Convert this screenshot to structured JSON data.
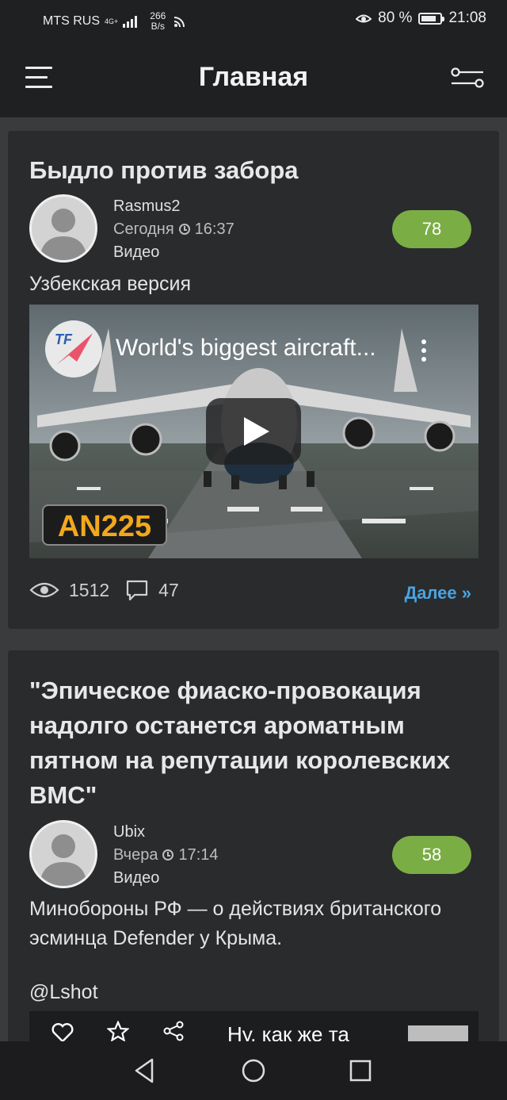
{
  "status_bar": {
    "carrier": "MTS RUS",
    "network": "4G+",
    "speed_value": "266",
    "speed_unit": "B/s",
    "battery_percent": "80 %",
    "battery_level": 0.8,
    "time": "21:08"
  },
  "app_bar": {
    "title": "Главная",
    "menu_icon": "menu-icon",
    "filter_icon": "filter-icon"
  },
  "posts": [
    {
      "title": "Быдло против забора",
      "author": "Rasmus2",
      "date": "Сегодня",
      "time": "16:37",
      "category": "Видео",
      "rating": "78",
      "description": "Узбекская версия",
      "video": {
        "title": "World's biggest aircraft...",
        "channel_logo": "TF",
        "badge": "AN225"
      },
      "views": "1512",
      "comments": "47",
      "more_label": "Далее »"
    },
    {
      "title": "\"Эпическое фиаско-провокация надолго останется ароматным пятном на репутации королевских ВМС\"",
      "author": "Ubix",
      "date": "Вчера",
      "time": "17:14",
      "category": "Видео",
      "rating": "58",
      "description": "Минобороны РФ — о действиях британского эсминца Defender у Крыма.",
      "handle": "@Lshot",
      "video": {
        "title": "Ну, как же та"
      }
    }
  ],
  "colors": {
    "background": "#3a3b3d",
    "card": "#2a2b2d",
    "accent_green": "#7bad45",
    "link_blue": "#4aa3e0"
  }
}
